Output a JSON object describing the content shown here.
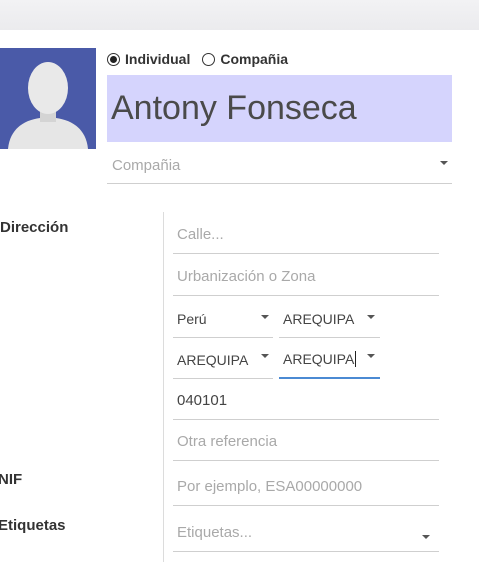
{
  "partner_type": {
    "options": [
      {
        "label": "Individual",
        "selected": true
      },
      {
        "label": "Compañia",
        "selected": false
      }
    ]
  },
  "name": "Antony Fonseca",
  "company": {
    "placeholder": "Compañia"
  },
  "labels": {
    "address": "Dirección",
    "nif": "NIF",
    "tags": "Etiquetas"
  },
  "address": {
    "street_placeholder": "Calle...",
    "zone_placeholder": "Urbanización o Zona",
    "country": "Perú",
    "state": "AREQUIPA",
    "province": "AREQUIPA",
    "district": "AREQUIPA",
    "zip": "040101",
    "reference_placeholder": "Otra referencia"
  },
  "nif": {
    "placeholder": "Por ejemplo, ESA00000000"
  },
  "tags": {
    "placeholder": "Etiquetas..."
  },
  "colors": {
    "name_bg": "#d5d4fd",
    "avatar_bg": "#4a5aa8",
    "focus": "#4b8ad3"
  },
  "icons": [
    "avatar-placeholder-icon",
    "dropdown-caret-icon"
  ]
}
